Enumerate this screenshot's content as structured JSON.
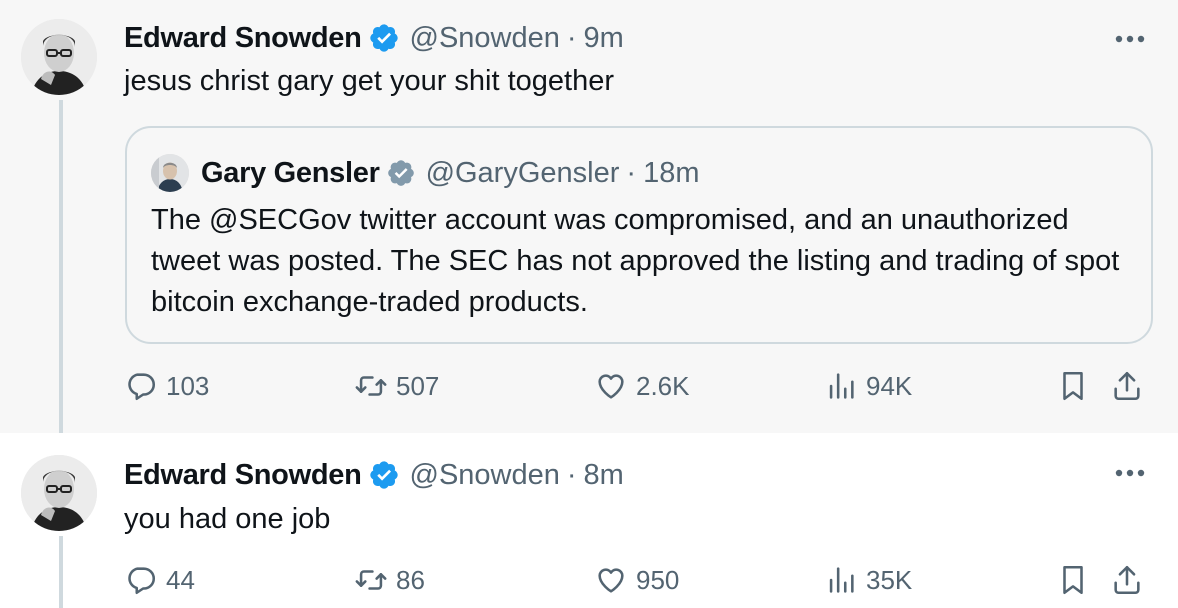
{
  "tweets": [
    {
      "author": {
        "name": "Edward Snowden",
        "handle": "@Snowden"
      },
      "time": "9m",
      "text": "jesus christ gary get your shit together",
      "quote": {
        "author": {
          "name": "Gary Gensler",
          "handle": "@GaryGensler"
        },
        "time": "18m",
        "text": "The @SECGov twitter account was compromised, and an unauthorized tweet was posted. The SEC has not approved the listing and trading of spot bitcoin exchange-traded products."
      },
      "stats": {
        "replies": "103",
        "reposts": "507",
        "likes": "2.6K",
        "views": "94K"
      }
    },
    {
      "author": {
        "name": "Edward Snowden",
        "handle": "@Snowden"
      },
      "time": "8m",
      "text": "you had one job",
      "stats": {
        "replies": "44",
        "reposts": "86",
        "likes": "950",
        "views": "35K"
      }
    }
  ],
  "separator": "·",
  "colors": {
    "verified_blue": "#1d9bf0",
    "verified_gray": "#829aab",
    "muted_text": "#536471",
    "border": "#cfd9de"
  },
  "icons": [
    "verified-badge-icon",
    "more-icon",
    "reply-icon",
    "repost-icon",
    "like-icon",
    "views-icon",
    "bookmark-icon",
    "share-icon"
  ]
}
